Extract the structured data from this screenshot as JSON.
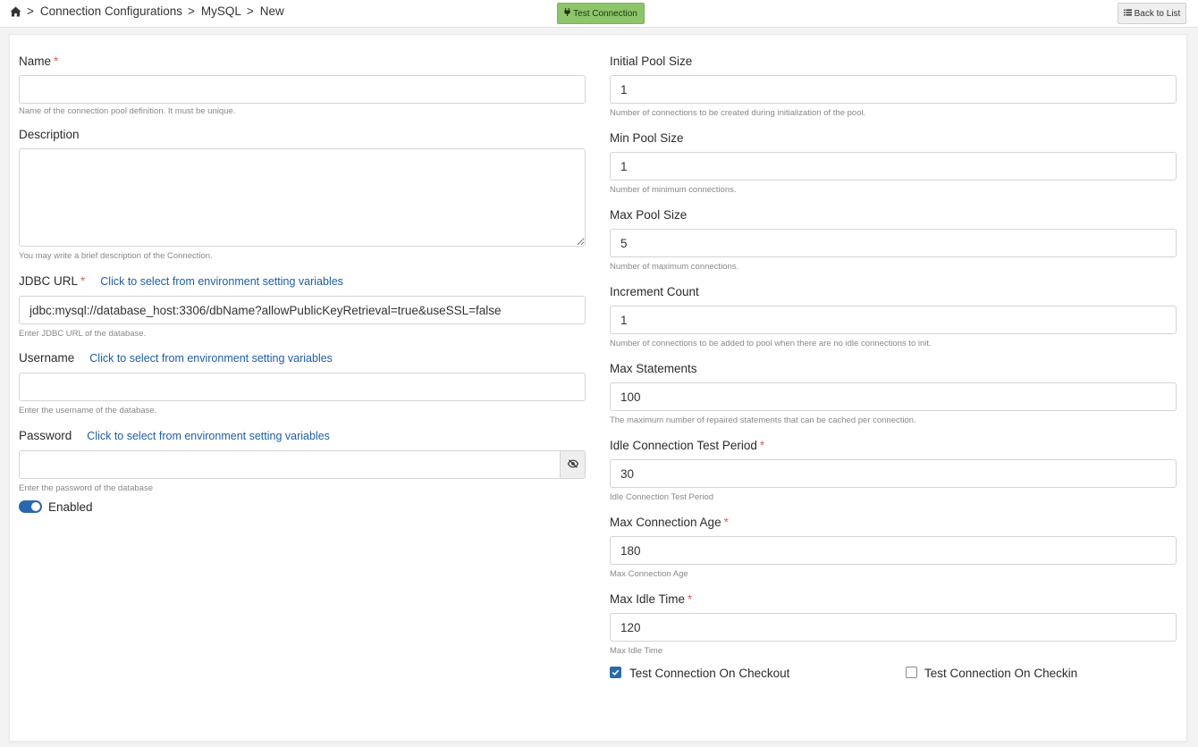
{
  "breadcrumb": {
    "sep": ">",
    "items": [
      "Connection Configurations",
      "MySQL",
      "New"
    ]
  },
  "toolbar": {
    "test_connection": "Test Connection",
    "back_to_list": "Back to List"
  },
  "colors": {
    "accent": "#2a68ae",
    "test_button": "#8cc56a",
    "required": "#e06060",
    "link": "#1d5ea8"
  },
  "left": {
    "env_link": "Click to select from environment setting variables",
    "name": {
      "label": "Name",
      "required": "*",
      "value": "",
      "help": "Name of the connection pool definition. It must be unique."
    },
    "description": {
      "label": "Description",
      "value": "",
      "help": "You may write a brief description of the Connection."
    },
    "jdbc": {
      "label": "JDBC URL",
      "required": "*",
      "value": "jdbc:mysql://database_host:3306/dbName?allowPublicKeyRetrieval=true&useSSL=false",
      "help": "Enter JDBC URL of the database."
    },
    "username": {
      "label": "Username",
      "value": "",
      "help": "Enter the username of the database."
    },
    "password": {
      "label": "Password",
      "value": "",
      "help": "Enter the password of the database"
    },
    "enabled": {
      "label": "Enabled",
      "on": true
    }
  },
  "right": {
    "initial_pool": {
      "label": "Initial Pool Size",
      "value": "1",
      "help": "Number of connections to be created during initialization of the pool."
    },
    "min_pool": {
      "label": "Min Pool Size",
      "value": "1",
      "help": "Number of minimum connections."
    },
    "max_pool": {
      "label": "Max Pool Size",
      "value": "5",
      "help": "Number of maximum connections."
    },
    "increment": {
      "label": "Increment Count",
      "value": "1",
      "help": "Number of connections to be added to pool when there are no idle connections to init."
    },
    "max_statements": {
      "label": "Max Statements",
      "value": "100",
      "help": "The maximum number of repaired statements that can be cached per connection."
    },
    "idle_test": {
      "label": "Idle Connection Test Period",
      "required": "*",
      "value": "30",
      "help": "Idle Connection Test Period"
    },
    "max_age": {
      "label": "Max Connection Age",
      "required": "*",
      "value": "180",
      "help": "Max Connection Age"
    },
    "max_idle": {
      "label": "Max Idle Time",
      "required": "*",
      "value": "120",
      "help": "Max Idle Time"
    },
    "checkout": {
      "label": "Test Connection On Checkout",
      "checked": true
    },
    "checkin": {
      "label": "Test Connection On Checkin",
      "checked": false
    }
  }
}
